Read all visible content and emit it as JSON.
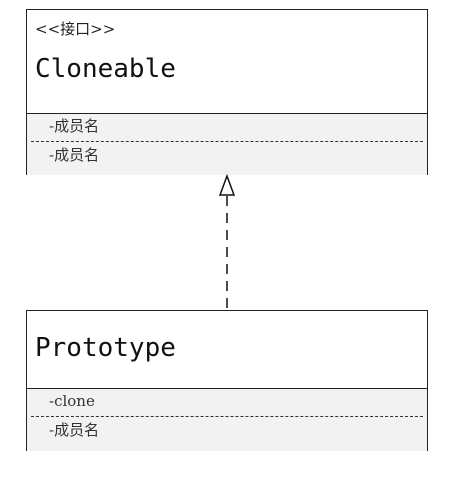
{
  "diagram": {
    "classes": [
      {
        "stereotype": "<<接口>>",
        "name": "Cloneable",
        "members": [
          "-成员名",
          "-成员名"
        ]
      },
      {
        "stereotype": "",
        "name": "Prototype",
        "members": [
          "-clone",
          "-成员名"
        ]
      }
    ],
    "relation": {
      "type": "realization",
      "from": "Prototype",
      "to": "Cloneable"
    }
  }
}
